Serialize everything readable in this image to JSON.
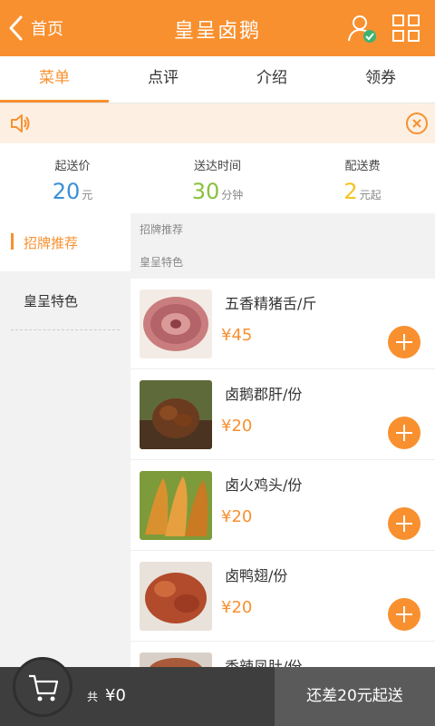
{
  "header": {
    "back_label": "首页",
    "title": "皇呈卤鹅"
  },
  "tabs": [
    {
      "label": "菜单",
      "active": true
    },
    {
      "label": "点评"
    },
    {
      "label": "介绍"
    },
    {
      "label": "领券"
    }
  ],
  "info": [
    {
      "label": "起送价",
      "value": "20",
      "unit": "元",
      "color": "#3a8fd8"
    },
    {
      "label": "送达时间",
      "value": "30",
      "unit": "分钟",
      "color": "#8ac13c"
    },
    {
      "label": "配送费",
      "value": "2",
      "unit": "元起",
      "color": "#f2c521"
    }
  ],
  "sidebar": {
    "items": [
      {
        "label": "招牌推荐",
        "active": true
      },
      {
        "label": "皇呈特色"
      }
    ]
  },
  "sections": {
    "first": "招牌推荐",
    "second": "皇呈特色"
  },
  "items": [
    {
      "name": "五香精猪舌/斤",
      "price": "¥45"
    },
    {
      "name": "卤鹅郡肝/份",
      "price": "¥20"
    },
    {
      "name": "卤火鸡头/份",
      "price": "¥20"
    },
    {
      "name": "卤鸭翅/份",
      "price": "¥20"
    },
    {
      "name": "香辣凤肚/份",
      "price": ""
    }
  ],
  "cart": {
    "prefix": "共",
    "total": "¥0",
    "checkout_label": "还差20元起送"
  },
  "colors": {
    "accent": "#f8902f",
    "bottom_bar": "#3e3e3e"
  }
}
